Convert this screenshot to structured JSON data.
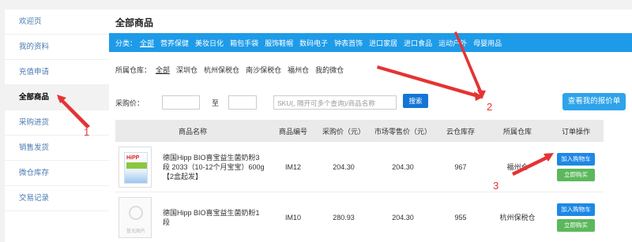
{
  "sidebar": {
    "items": [
      {
        "label": "欢迎页"
      },
      {
        "label": "我的资料"
      },
      {
        "label": "充值申请"
      },
      {
        "label": "全部商品"
      },
      {
        "label": "采购进货"
      },
      {
        "label": "销售发货"
      },
      {
        "label": "微仓库存"
      },
      {
        "label": "交易记录"
      }
    ],
    "active": "全部商品"
  },
  "page": {
    "title": "全部商品"
  },
  "categories": {
    "label": "分类：",
    "items": [
      "全部",
      "营养保健",
      "美妆日化",
      "箱包手袋",
      "服饰鞋帽",
      "数码电子",
      "钟表首饰",
      "进口家居",
      "进口食品",
      "运动户外",
      "母婴用品"
    ],
    "selected": "全部"
  },
  "warehouses": {
    "label": "所属仓库：",
    "items": [
      "全部",
      "深圳仓",
      "杭州保税仓",
      "南沙保税仓",
      "福州仓",
      "我的微仓"
    ],
    "selected": "全部"
  },
  "filter": {
    "price_label": "采购价：",
    "to_label": "至",
    "search_placeholder": "SKU(, 隔开可多个查询)/商品名称",
    "search_button": "搜索",
    "quote_button": "查看我的报价单"
  },
  "table": {
    "headers": [
      "商品名称",
      "商品编号",
      "采购价（元）",
      "市场零售价（元）",
      "云仓库存",
      "所属仓库",
      "订单操作"
    ],
    "rows": [
      {
        "name": "德国Hipp BIO喜宝益生菌奶粉3段 2033（10-12个月宝宝）600g【2盒起发】",
        "code": "IM12",
        "price": "204.30",
        "market_price": "204.30",
        "stock": "967",
        "warehouse": "福州仓",
        "image": "hipp-box",
        "cart": "加入购物车",
        "buy": "立即购买"
      },
      {
        "name": "德国Hipp BIO喜宝益生菌奶粉1段",
        "code": "IM10",
        "price": "280.93",
        "market_price": "204.30",
        "stock": "955",
        "warehouse": "杭州保税仓",
        "image": "no-image",
        "no_image_text": "暂无图片",
        "cart": "加入购物车",
        "buy": "立即购买"
      }
    ]
  },
  "hipp_logo": "HiPP",
  "annotations": {
    "a1": "1",
    "a2": "2",
    "a3": "3"
  },
  "colors": {
    "accent": "#1e9be8",
    "annotation": "#e53333",
    "buy": "#5cb85c",
    "cart": "#1e88e5"
  }
}
